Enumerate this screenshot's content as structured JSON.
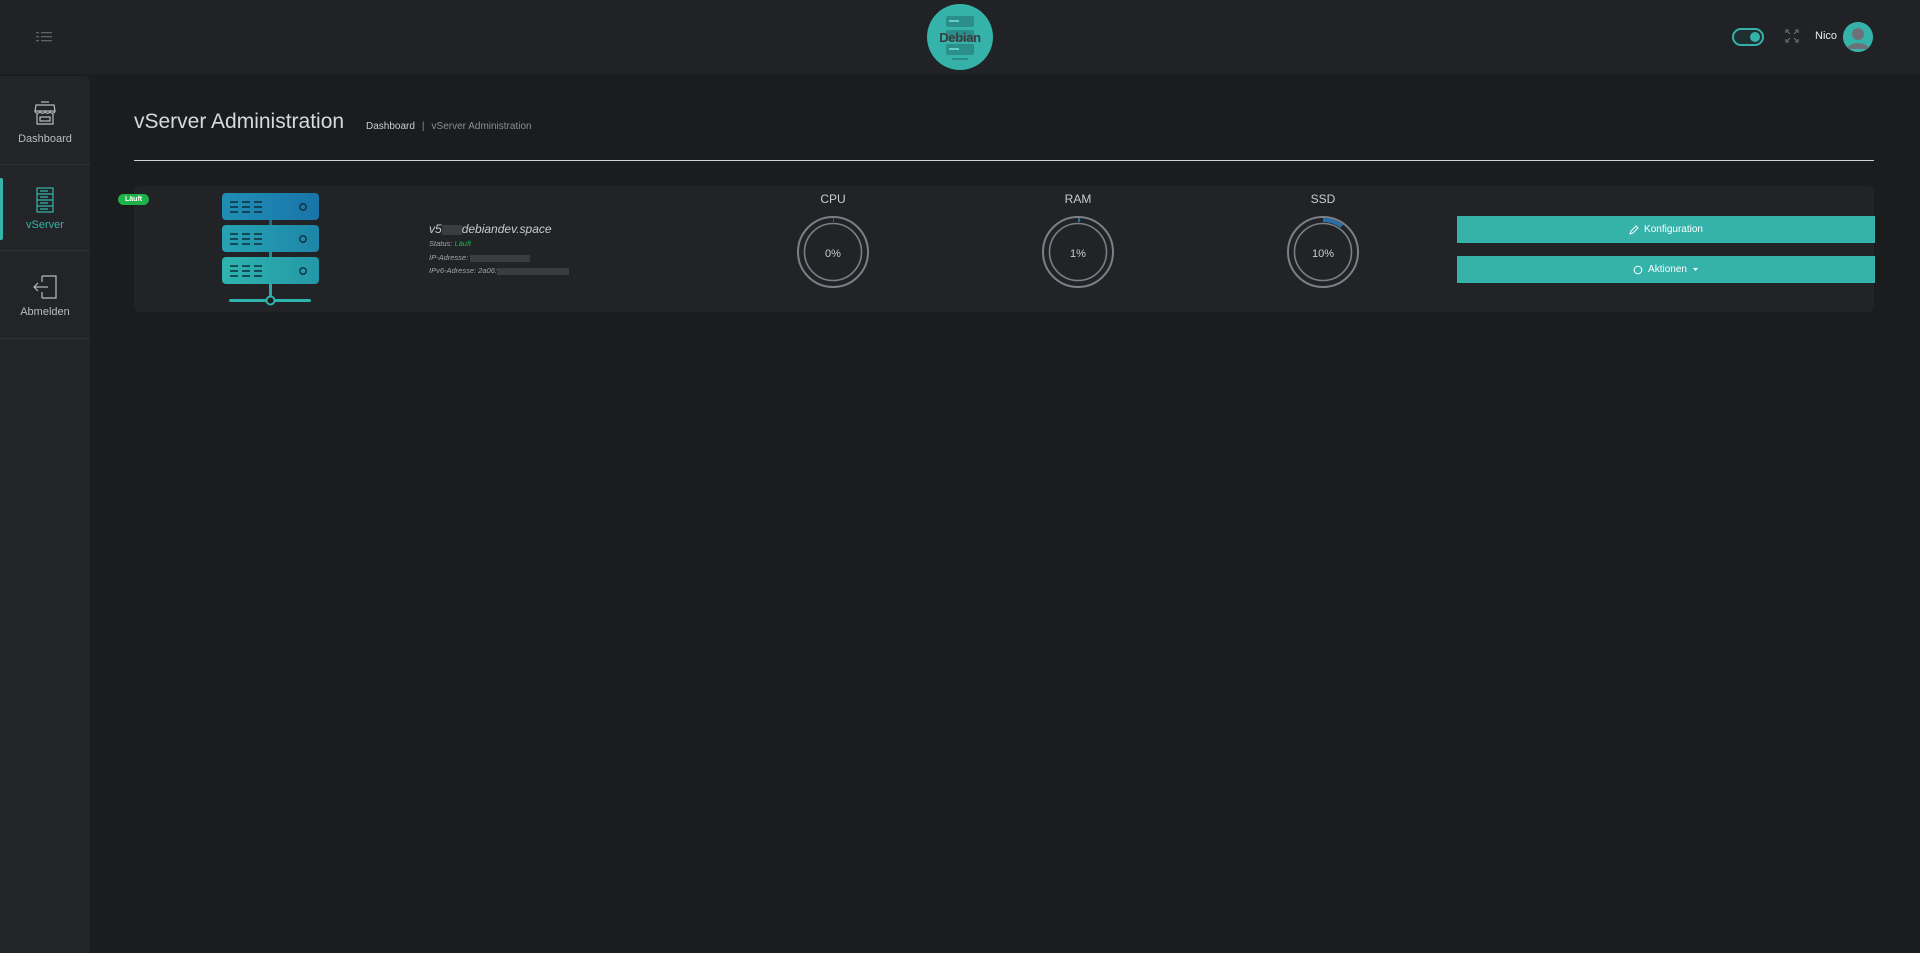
{
  "header": {
    "logo_text": "Debian",
    "username": "Nico"
  },
  "sidebar": {
    "items": [
      {
        "label": "Dashboard",
        "icon": "shop-icon"
      },
      {
        "label": "vServer",
        "icon": "server-icon"
      },
      {
        "label": "Abmelden",
        "icon": "logout-icon"
      }
    ]
  },
  "page": {
    "title": "vServer Administration",
    "breadcrumb": [
      "Dashboard",
      "|",
      "vServer Administration"
    ]
  },
  "server": {
    "badge": "Läuft",
    "name_prefix": "v5",
    "name_suffix": "debiandev.space",
    "status_label": "Status:",
    "status_value": "Läuft",
    "ip_label": "IP-Adresse:",
    "ipv6_label": "IPv6-Adresse: 2a06:"
  },
  "gauges": [
    {
      "label": "CPU",
      "value": "0%",
      "fraction": 0.0
    },
    {
      "label": "RAM",
      "value": "1%",
      "fraction": 0.01
    },
    {
      "label": "SSD",
      "value": "10%",
      "fraction": 0.1
    }
  ],
  "actions": {
    "config_label": "Konfiguration",
    "actions_label": "Aktionen"
  },
  "colors": {
    "accent": "#35b2aa",
    "status_green": "#1db348",
    "background": "#1a1c1e"
  }
}
